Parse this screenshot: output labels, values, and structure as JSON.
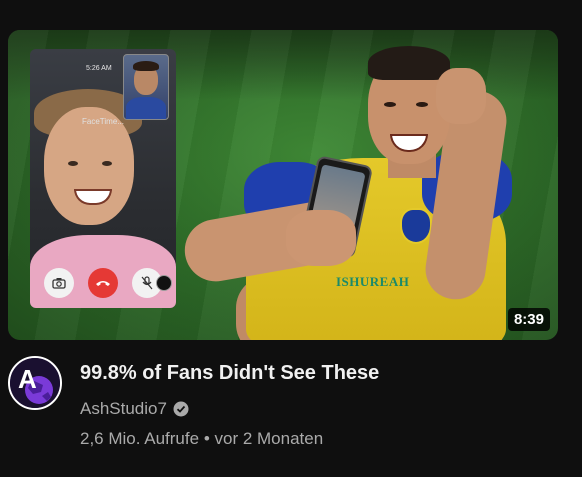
{
  "phone": {
    "time": "5:26 AM",
    "caption": "FaceTime..."
  },
  "thumbnail": {
    "sponsor_text": "ISHUREAH",
    "duration": "8:39"
  },
  "video": {
    "title": "99.8% of Fans Didn't See These",
    "channel": "AshStudio7",
    "views": "2,6 Mio. Aufrufe",
    "separator": "•",
    "age": "vor 2 Monaten"
  },
  "icons": {
    "avatar": "ash-studio-logo",
    "verified": "verified-check-icon",
    "camera": "camera-icon",
    "end_call": "end-call-icon",
    "mute": "mic-off-icon"
  },
  "colors": {
    "background": "#0f0f0f",
    "end_call": "#e53935",
    "jersey_yellow": "#e4c92a",
    "jersey_blue": "#1f3fae"
  }
}
